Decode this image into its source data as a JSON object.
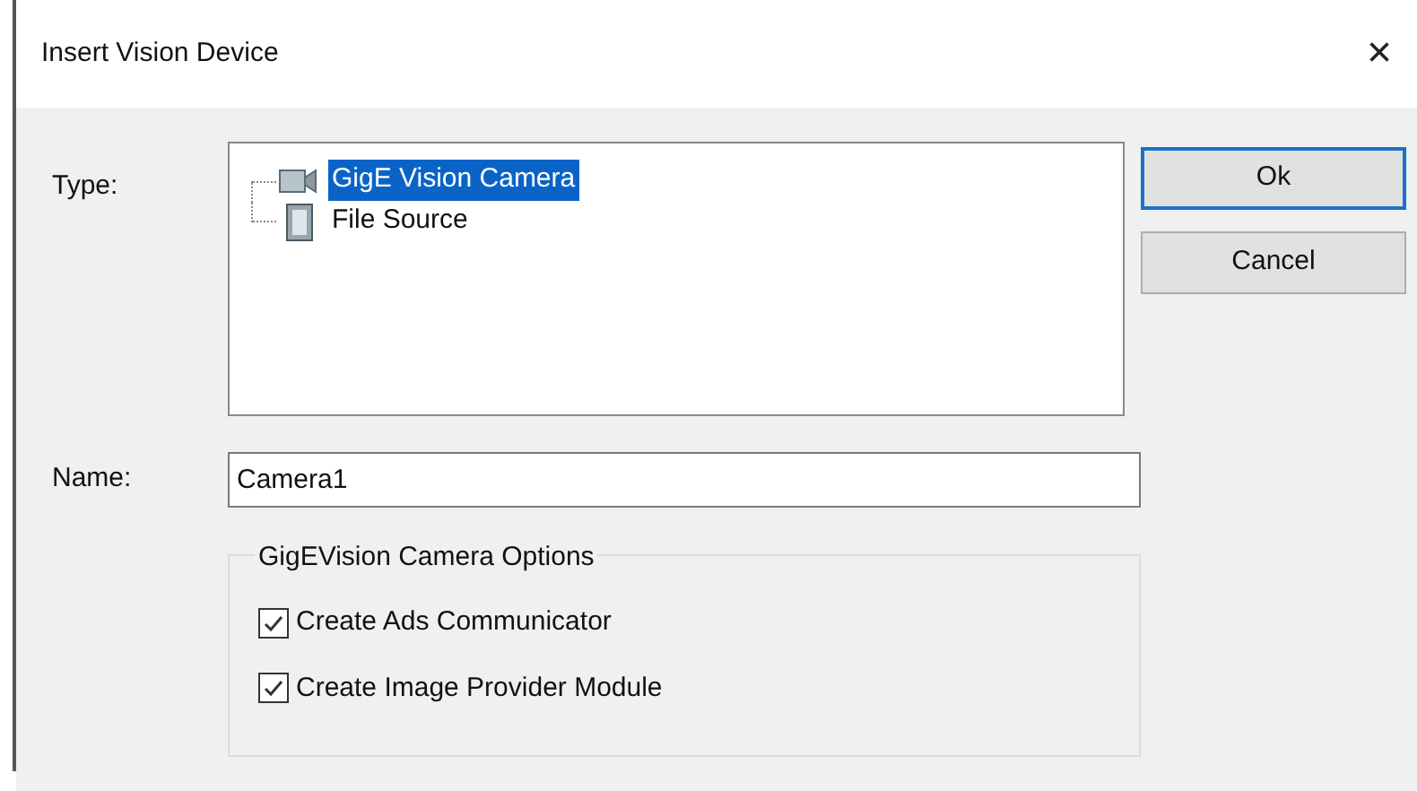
{
  "window": {
    "title": "Insert Vision Device",
    "close": "×"
  },
  "type_label": "Type:",
  "tree": [
    {
      "label": "GigE Vision Camera",
      "kind": "camera",
      "selected": true
    },
    {
      "label": "File Source",
      "kind": "file",
      "selected": false
    }
  ],
  "buttons": [
    {
      "label": "Ok",
      "default": true
    },
    {
      "label": "Cancel",
      "default": false
    }
  ],
  "name_label": "Name:",
  "name_value": "Camera1",
  "options": {
    "title": "GigEVision Camera Options",
    "items": [
      {
        "label": "Create Ads Communicator",
        "checked": true
      },
      {
        "label": "Create Image Provider Module",
        "checked": true
      }
    ]
  }
}
